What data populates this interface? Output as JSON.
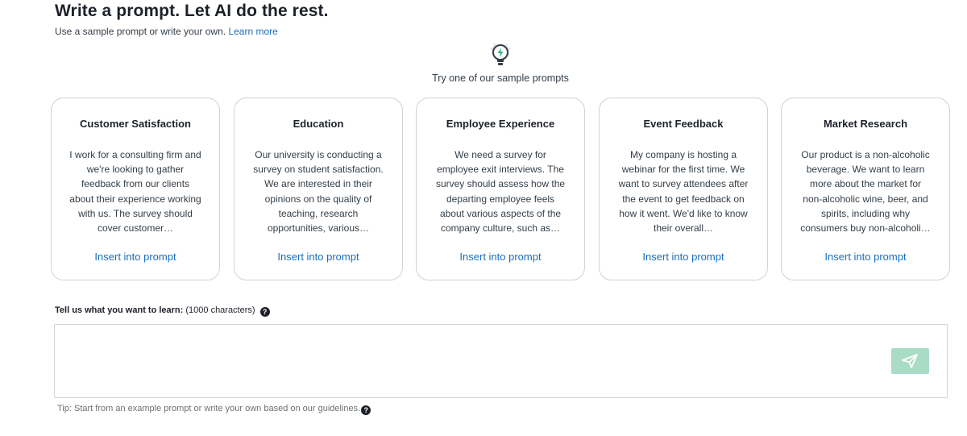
{
  "header": {
    "title": "Write a prompt. Let AI do the rest.",
    "subtitle": "Use a sample prompt or write your own.",
    "learn_more": "Learn more"
  },
  "samples": {
    "intro": "Try one of our sample prompts",
    "bulb_icon": "lightbulb-icon",
    "cards": [
      {
        "title": "Customer Satisfaction",
        "body": "I work for a consulting firm and we're looking to gather feedback from our clients about their experience working with us. The survey should cover customer…",
        "link": "Insert into prompt"
      },
      {
        "title": "Education",
        "body": "Our university is conducting a survey on student satisfaction. We are interested in their opinions on the quality of teaching, research opportunities, various…",
        "link": "Insert into prompt"
      },
      {
        "title": "Employee Experience",
        "body": "We need a survey for employee exit interviews. The survey should assess how the departing employee feels about various aspects of the company culture, such as…",
        "link": "Insert into prompt"
      },
      {
        "title": "Event Feedback",
        "body": "My company is hosting a webinar for the first time. We want to survey attendees after the event to get feedback on how it went. We'd like to know their overall…",
        "link": "Insert into prompt"
      },
      {
        "title": "Market Research",
        "body": "Our product is a non-alcoholic beverage. We want to learn more about the market for non-alcoholic wine, beer, and spirits, including why consumers buy non-alcoholi…",
        "link": "Insert into prompt"
      }
    ]
  },
  "prompt": {
    "label": "Tell us what you want to learn:",
    "limit": "(1000 characters)",
    "help_icon": "?",
    "value": "",
    "placeholder": "",
    "send_icon": "send-icon",
    "send_color": "#a9dcc5"
  },
  "tip": {
    "text": "Tip: Start from an example prompt or write your own based on our guidelines.",
    "help_icon": "?"
  },
  "colors": {
    "link": "#1a6dbd",
    "card_border": "#d0d2d3",
    "bulb_accent": "#2fb380"
  }
}
